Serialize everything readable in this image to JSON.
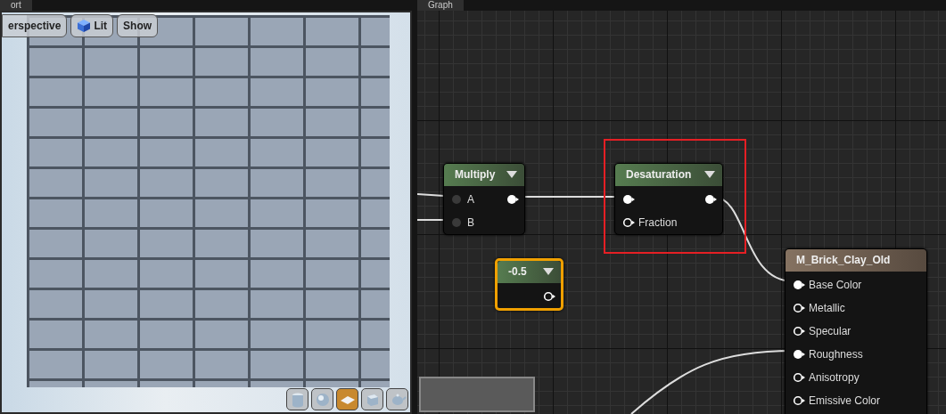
{
  "viewport": {
    "tab": "ort",
    "toolbar": [
      {
        "kind": "text",
        "label": "erspective"
      },
      {
        "kind": "cube",
        "label": "Lit"
      },
      {
        "kind": "text",
        "label": "Show"
      }
    ],
    "preview_shapes": [
      {
        "kind": "cylinder",
        "selected": false
      },
      {
        "kind": "sphere",
        "selected": false
      },
      {
        "kind": "plane",
        "selected": true
      },
      {
        "kind": "cube",
        "selected": false
      },
      {
        "kind": "teapot",
        "selected": false
      }
    ]
  },
  "graph": {
    "tab": "Graph",
    "nodes": [
      {
        "kind": "function",
        "title": "Multiply",
        "selected": false,
        "highlighted": false,
        "inputs": [
          {
            "label": "A",
            "connected": true,
            "dimmed": true
          },
          {
            "label": "B",
            "connected": true,
            "dimmed": true
          }
        ],
        "output": {
          "connected": true
        }
      },
      {
        "kind": "function",
        "title": "Desaturation",
        "selected": false,
        "highlighted": true,
        "inputs": [
          {
            "connected": true,
            "dimmed": false
          },
          {
            "label": "Fraction",
            "connected": false,
            "dimmed": false
          }
        ],
        "output": {
          "connected": true
        }
      },
      {
        "kind": "constant",
        "title": "-0.5",
        "selected": true,
        "highlighted": false,
        "output": {
          "connected": false
        }
      },
      {
        "kind": "result",
        "title": "M_Brick_Clay_Old",
        "selected": false,
        "highlighted": false,
        "inputs": [
          {
            "label": "Base Color",
            "connected": true,
            "dimmed": false
          },
          {
            "label": "Metallic",
            "connected": false,
            "dimmed": false
          },
          {
            "label": "Specular",
            "connected": false,
            "dimmed": false
          },
          {
            "label": "Roughness",
            "connected": true,
            "dimmed": false
          },
          {
            "label": "Anisotropy",
            "connected": false,
            "dimmed": false
          },
          {
            "label": "Emissive Color",
            "connected": false,
            "dimmed": false
          }
        ]
      }
    ]
  }
}
